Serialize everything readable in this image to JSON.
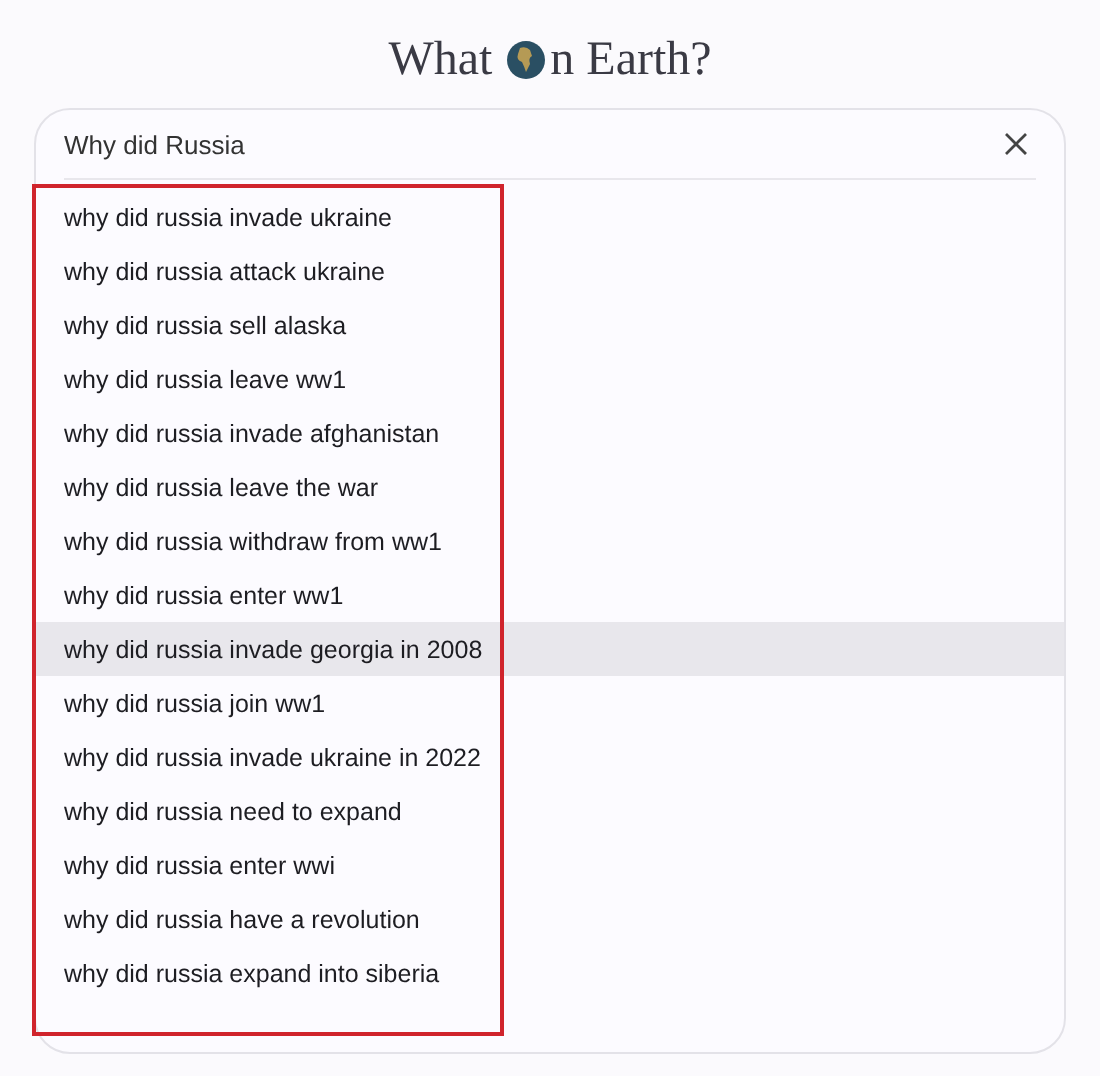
{
  "logo": {
    "before_globe": "What",
    "after_globe": "n Earth?"
  },
  "search": {
    "value": "Why did Russia"
  },
  "suggestions": [
    {
      "text": "why did russia invade ukraine",
      "selected": false
    },
    {
      "text": "why did russia attack ukraine",
      "selected": false
    },
    {
      "text": "why did russia sell alaska",
      "selected": false
    },
    {
      "text": "why did russia leave ww1",
      "selected": false
    },
    {
      "text": "why did russia invade afghanistan",
      "selected": false
    },
    {
      "text": "why did russia leave the war",
      "selected": false
    },
    {
      "text": "why did russia withdraw from ww1",
      "selected": false
    },
    {
      "text": "why did russia enter ww1",
      "selected": false
    },
    {
      "text": "why did russia invade georgia in 2008",
      "selected": true
    },
    {
      "text": "why did russia join ww1",
      "selected": false
    },
    {
      "text": "why did russia invade ukraine in 2022",
      "selected": false
    },
    {
      "text": "why did russia need to expand",
      "selected": false
    },
    {
      "text": "why did russia enter wwi",
      "selected": false
    },
    {
      "text": "why did russia have a revolution",
      "selected": false
    },
    {
      "text": "why did russia expand into siberia",
      "selected": false
    }
  ]
}
